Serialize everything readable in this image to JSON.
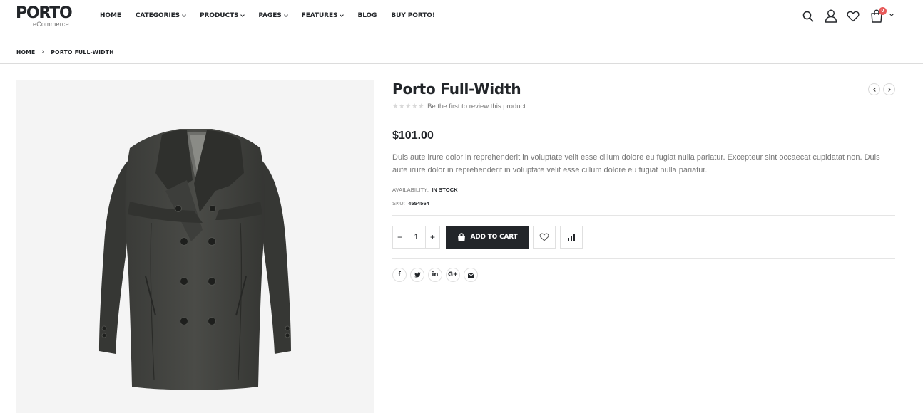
{
  "logo": {
    "main": "PORTO",
    "sub": "eCommerce"
  },
  "nav": {
    "items": [
      {
        "label": "HOME",
        "has_dropdown": false
      },
      {
        "label": "CATEGORIES",
        "has_dropdown": true
      },
      {
        "label": "PRODUCTS",
        "has_dropdown": true
      },
      {
        "label": "PAGES",
        "has_dropdown": true
      },
      {
        "label": "FEATURES",
        "has_dropdown": true
      },
      {
        "label": "BLOG",
        "has_dropdown": false
      },
      {
        "label": "BUY PORTO!",
        "has_dropdown": false
      }
    ]
  },
  "header_icons": {
    "search": "search-icon",
    "account": "user-icon",
    "wishlist": "heart-icon",
    "cart": "shopping-bag-icon",
    "cart_count": "0",
    "cart_badge_color": "#e85a5a"
  },
  "breadcrumb": {
    "home": "HOME",
    "separator": "›",
    "current": "PORTO FULL-WIDTH"
  },
  "product": {
    "image_alt": "coat",
    "title": "Porto Full-Width",
    "rating_stars": 0,
    "stars_text": "★★★★★",
    "review_link": "Be the first to review this product",
    "price": "$101.00",
    "description": "Duis aute irure dolor in reprehenderit in voluptate velit esse cillum dolore eu fugiat nulla pariatur. Excepteur sint occaecat cupidatat non. Duis aute irure dolor in reprehenderit in voluptate velit esse cillum dolore eu fugiat nulla pariatur.",
    "availability_label": "AVAILABILITY:",
    "availability_value": "IN STOCK",
    "sku_label": "SKU:",
    "sku_value": "4554564",
    "quantity": "1",
    "qty_minus": "−",
    "qty_plus": "+",
    "add_to_cart": "ADD TO CART",
    "accent_color": "#222529"
  },
  "share": {
    "facebook": "f",
    "twitter": "t",
    "linkedin": "in",
    "google": "G+",
    "email": "email"
  }
}
